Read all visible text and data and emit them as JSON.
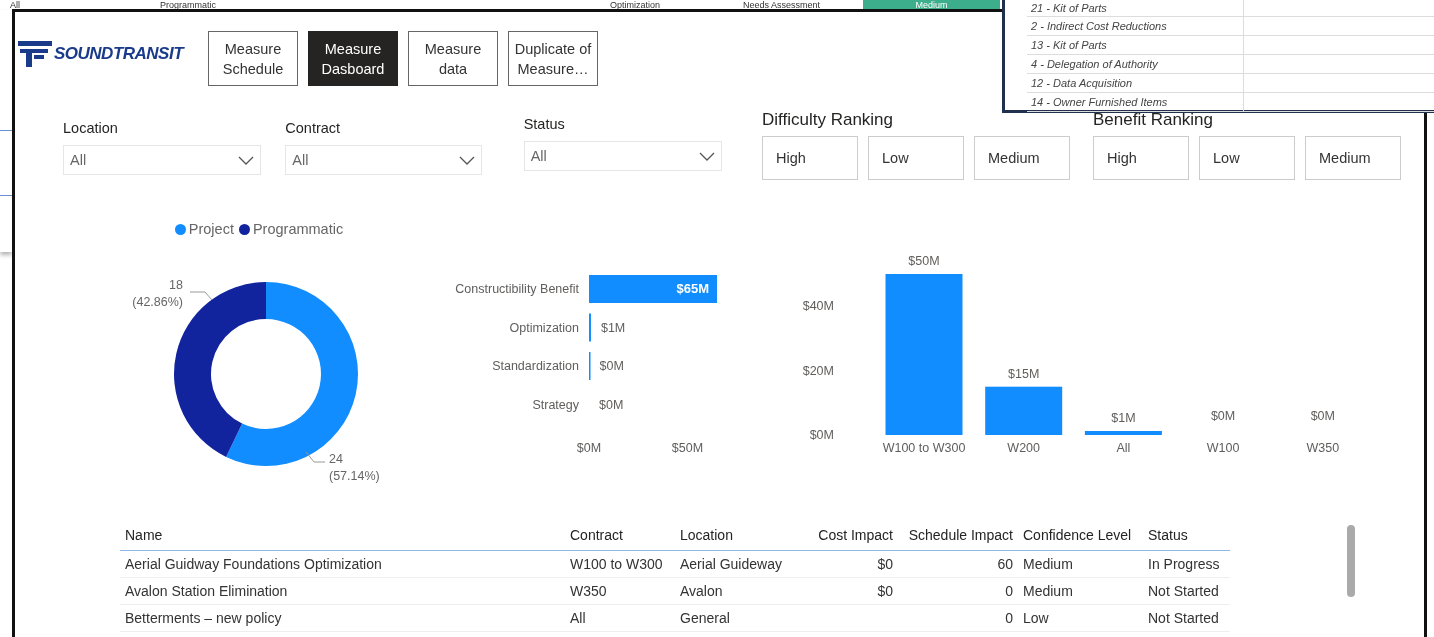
{
  "background_sheet": {
    "cells": [
      {
        "text": "All",
        "kind": "plain"
      },
      {
        "text": "Programmatic",
        "kind": "plain"
      },
      {
        "text": "Optimization",
        "kind": "plain"
      },
      {
        "text": "Needs Assessment",
        "kind": "plain"
      },
      {
        "text": "Medium",
        "kind": "highlight"
      }
    ]
  },
  "side_list": {
    "items": [
      "21 - Kit of Parts",
      "2 - Indirect Cost Reductions",
      "13 - Kit of Parts",
      "4 - Delegation of Authority",
      "12 - Data Acquisition",
      "14 - Owner Furnished Items"
    ]
  },
  "logo": {
    "text": "SOUNDTRANSIT"
  },
  "nav_buttons": [
    {
      "label": "Measure Schedule",
      "selected": false
    },
    {
      "label": "Measure Dasboard",
      "selected": true
    },
    {
      "label": "Measure data",
      "selected": false
    },
    {
      "label": "Duplicate of Measure…",
      "selected": false
    }
  ],
  "filters": [
    {
      "label": "Location",
      "value": "All"
    },
    {
      "label": "Contract",
      "value": "All"
    },
    {
      "label": "Status",
      "value": "All"
    }
  ],
  "rankings": [
    {
      "title": "Difficulty Ranking",
      "options": [
        {
          "label": "High",
          "selected": false
        },
        {
          "label": "Low",
          "selected": false
        },
        {
          "label": "Medium",
          "selected": false
        }
      ]
    },
    {
      "title": "Benefit Ranking",
      "options": [
        {
          "label": "High",
          "selected": false
        },
        {
          "label": "Low",
          "selected": false
        },
        {
          "label": "Medium",
          "selected": false
        }
      ]
    }
  ],
  "type_chart": {
    "chart_data": {
      "type": "donut",
      "categories": [
        "Project",
        "Programmatic"
      ],
      "legend": "top",
      "series": [
        {
          "colors": [
            "#118dff",
            "#12239e"
          ],
          "values": [
            57.14,
            42.86
          ]
        }
      ],
      "value_labels": [
        "24 (57.14%)",
        "18 (42.86%)"
      ]
    }
  },
  "category_chart": {
    "chart_data": {
      "type": "bar",
      "orientation": "horizontal",
      "categories": [
        "Constructibility Benefit",
        "Optimization",
        "Standardization",
        "Strategy"
      ],
      "series": [
        {
          "color": "#118dff",
          "values": [
            65,
            1,
            0.3,
            0
          ]
        }
      ],
      "value_labels": [
        "$65M",
        "$1M",
        "$0M",
        "$0M"
      ],
      "xlim": [
        0,
        65
      ],
      "xticks": [
        {
          "value": 0,
          "label": "$0M"
        },
        {
          "value": 50,
          "label": "$50M"
        }
      ]
    }
  },
  "contract_chart": {
    "chart_data": {
      "type": "bar",
      "orientation": "vertical",
      "categories": [
        "W100 to W300",
        "W200",
        "All",
        "W100",
        "W350"
      ],
      "series": [
        {
          "color": "#118dff",
          "values": [
            50,
            15,
            1,
            0,
            0
          ]
        }
      ],
      "value_labels": [
        "$50M",
        "$15M",
        "$1M",
        "$0M",
        "$0M"
      ],
      "ylim": [
        0,
        50
      ],
      "yticks": [
        {
          "value": 0,
          "label": "$0M"
        },
        {
          "value": 20,
          "label": "$20M"
        },
        {
          "value": 40,
          "label": "$40M"
        }
      ]
    }
  },
  "table": {
    "columns": [
      "Name",
      "Contract",
      "Location",
      "Cost Impact",
      "Schedule Impact",
      "Confidence Level",
      "Status"
    ],
    "rows": [
      [
        "Aerial Guidway Foundations Optimization",
        "W100 to W300",
        "Aerial Guideway",
        "$0",
        "60",
        "Medium",
        "In Progress"
      ],
      [
        "Avalon Station Elimination",
        "W350",
        "Avalon",
        "$0",
        "0",
        "Medium",
        "Not Started"
      ],
      [
        "Betterments – new policy",
        "All",
        "General",
        "",
        "0",
        "Low",
        "Not Started"
      ]
    ]
  }
}
